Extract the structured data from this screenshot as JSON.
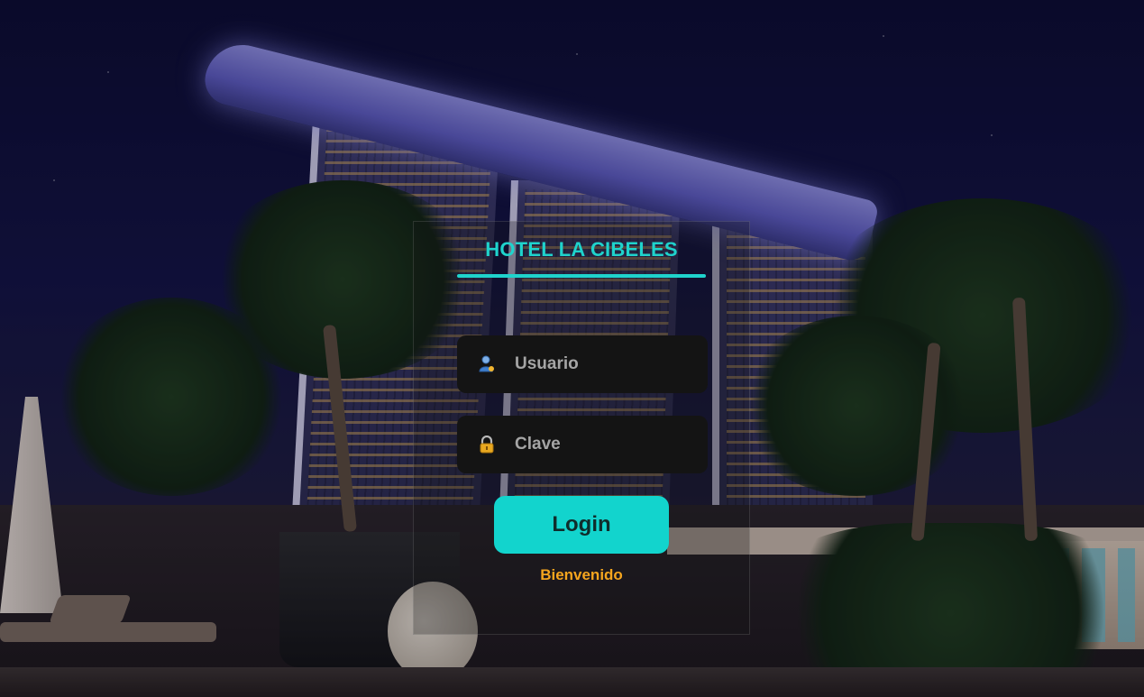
{
  "background": {
    "description_icon": "hotel-night-photo"
  },
  "login": {
    "title": "HOTEL LA CIBELES",
    "username": {
      "placeholder": "Usuario",
      "value": "",
      "icon": "user-icon"
    },
    "password": {
      "placeholder": "Clave",
      "value": "",
      "icon": "lock-icon"
    },
    "button_label": "Login",
    "welcome_text": "Bienvenido"
  },
  "colors": {
    "accent": "#1fd3cc",
    "button": "#12d4cd",
    "welcome": "#f5a51e",
    "field_bg": "#141414"
  }
}
